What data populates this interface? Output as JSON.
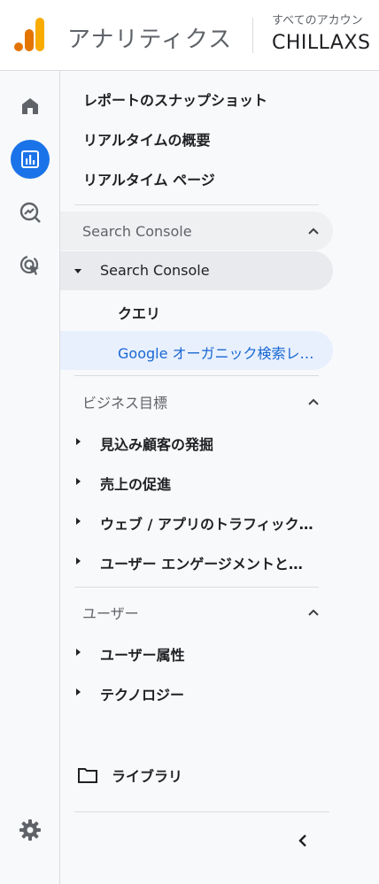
{
  "header": {
    "app_title": "アナリティクス",
    "account_label": "すべてのアカウン",
    "account_name": "CHILLAXS"
  },
  "rail": {
    "items": [
      {
        "icon": "home-icon"
      },
      {
        "icon": "reports-icon",
        "active": true
      },
      {
        "icon": "explore-icon"
      },
      {
        "icon": "advertising-icon"
      }
    ],
    "settings_icon": "gear-icon"
  },
  "nav": {
    "top_items": [
      {
        "label": "レポートのスナップショット"
      },
      {
        "label": "リアルタイムの概要"
      },
      {
        "label": "リアルタイム ページ"
      }
    ],
    "sections": [
      {
        "title": "Search Console",
        "expanded": true,
        "groups": [
          {
            "label": "Search Console",
            "expanded": true,
            "children": [
              {
                "label": "クエリ"
              },
              {
                "label": "Google オーガニック検索レ…",
                "active": true
              }
            ]
          }
        ]
      },
      {
        "title": "ビジネス目標",
        "expanded": true,
        "groups": [
          {
            "label": "見込み顧客の発掘"
          },
          {
            "label": "売上の促進"
          },
          {
            "label": "ウェブ / アプリのトラフィック…"
          },
          {
            "label": "ユーザー エンゲージメントと…"
          }
        ]
      },
      {
        "title": "ユーザー",
        "expanded": true,
        "groups": [
          {
            "label": "ユーザー属性"
          },
          {
            "label": "テクノロジー"
          }
        ]
      }
    ],
    "library_label": "ライブラリ"
  },
  "colors": {
    "accent": "#1a73e8",
    "active_bg": "#e8f0fe",
    "active_text": "#1967d2",
    "logo_orange": "#f9ab00",
    "logo_dark_orange": "#e37400"
  }
}
